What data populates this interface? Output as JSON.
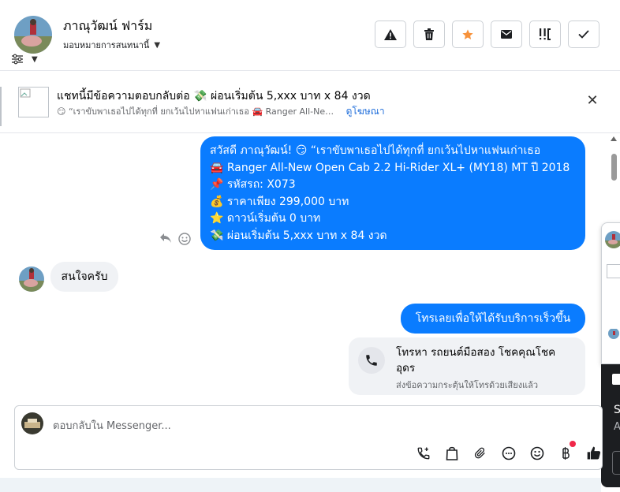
{
  "header": {
    "contact_name": "ภาณุวัฒน์ ฟาร์ม",
    "assign_label": "มอบหมายการสนทนานี้",
    "actions": [
      {
        "icon": "warning-icon",
        "name": "mark-spam-button"
      },
      {
        "icon": "trash-icon",
        "name": "delete-button"
      },
      {
        "icon": "star-icon",
        "name": "star-button"
      },
      {
        "icon": "envelope-icon",
        "name": "mark-unread-button"
      },
      {
        "icon": "follow-up-icon",
        "name": "follow-up-button"
      },
      {
        "icon": "check-icon",
        "name": "mark-done-button"
      }
    ]
  },
  "banner": {
    "title": "แชทนี้มีข้อความตอบกลับต่อ 💸 ผ่อนเริ่มต้น 5,xxx บาท x 84 งวด",
    "preview": "😏 “เราขับพาเธอไปได้ทุกที่ ยกเว้นไปหาแฟนเก่าเธอ 🚘 Ranger All-Ne…",
    "link": "ดูโฆษณา",
    "close": "✕"
  },
  "messages": {
    "out_1_lines": [
      "สวัสดี ภาณุวัฒน์! 😏 “เราขับพาเธอไปได้ทุกที่ ยกเว้นไปหาแฟนเก่าเธอ",
      "🚘 Ranger All-New Open Cab 2.2 Hi-Rider XL+ (MY18) MT ปี 2018",
      "📌 รหัสรถ: X073",
      "💰 ราคาเพียง 299,000 บาท",
      "⭐ ดาวน์เริ่มต้น 0 บาท",
      "💸 ผ่อนเริ่มต้น 5,xxx บาท x 84 งวด"
    ],
    "in_1": "สนใจครับ",
    "out_2": "โทรเลยเพื่อให้ได้รับบริการเร็วขึ้น",
    "call_card": {
      "title": "โทรหา รถยนต์มือสอง โชคคุณโชค อุดร",
      "subtitle": "ส่งข้อความกระตุ้นให้โทรด้วยเสียงแล้ว"
    }
  },
  "side_panel": {
    "dark_s": "S",
    "dark_a": "A"
  },
  "composer": {
    "placeholder": "ตอบกลับใน Messenger..."
  },
  "colors": {
    "outgoing_bubble": "#0a7cff",
    "incoming_bubble": "#f0f2f5",
    "star": "#f7923b",
    "link": "#216fdb"
  }
}
